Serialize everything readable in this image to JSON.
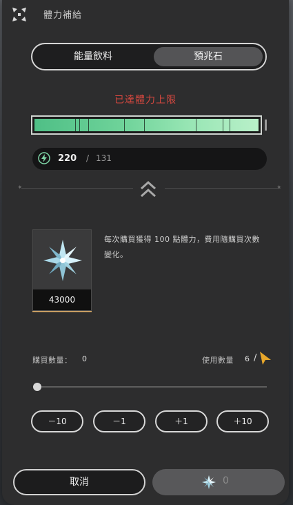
{
  "header": {
    "title": "體力補給",
    "logo_icon": "logo-icon"
  },
  "tabs": [
    {
      "label": "能量飲料",
      "active": false
    },
    {
      "label": "預兆石",
      "active": true
    }
  ],
  "notice": "已達體力上限",
  "stamina_bar": {
    "fill": 1.0,
    "color": "#6fd39a"
  },
  "energy": {
    "icon": "lightning-icon",
    "current": "220",
    "slash": "/",
    "max": "131"
  },
  "expand_icon": "double-chevron-up-icon",
  "item": {
    "icon": "omen-stone-icon",
    "price": "43000"
  },
  "description": "每次購買獲得 100 點體力，費用隨購買次數變化。",
  "purchase": {
    "label": "購買數量：",
    "value": "0"
  },
  "usage": {
    "label": "使用數量",
    "value": "6",
    "slash": "/"
  },
  "slider": {
    "value": 0
  },
  "steppers": [
    {
      "label": "－10"
    },
    {
      "label": "－1"
    },
    {
      "label": "＋1"
    },
    {
      "label": "＋10"
    }
  ],
  "footer": {
    "cancel_label": "取消",
    "buy_amount": "0",
    "buy_icon": "omen-stone-icon"
  },
  "colors": {
    "accent_red": "#d2473f",
    "bar_green": "#6fd39a",
    "card_border": "#c79d62"
  }
}
